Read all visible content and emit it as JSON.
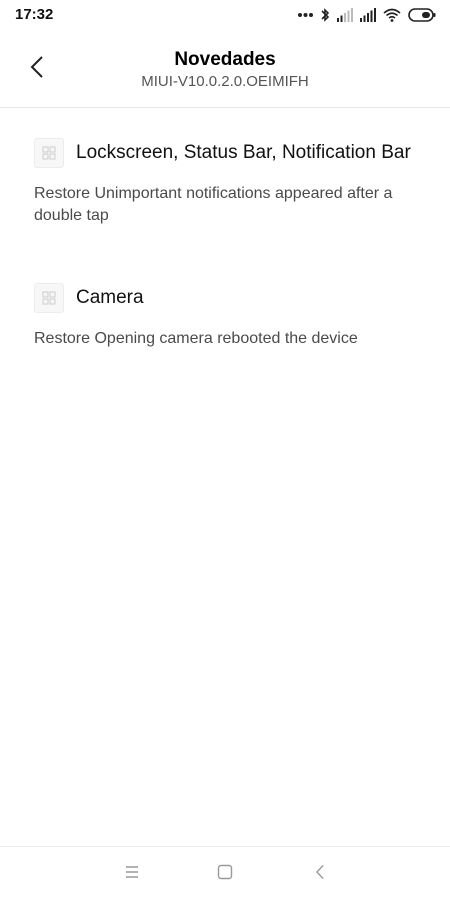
{
  "status_bar": {
    "time": "17:32",
    "icons": [
      "dots-icon",
      "bluetooth-icon",
      "signal-icon",
      "signal-icon",
      "wifi-icon",
      "battery-icon"
    ]
  },
  "header": {
    "title": "Novedades",
    "subtitle": "MIUI-V10.0.2.0.OEIMIFH"
  },
  "sections": [
    {
      "title": "Lockscreen, Status Bar, Notification Bar",
      "description": "Restore Unimportant notifications appeared after a double tap"
    },
    {
      "title": "Camera",
      "description": "Restore Opening camera rebooted the device"
    }
  ],
  "nav_bar": {
    "buttons": [
      "menu-icon",
      "home-icon",
      "back-icon"
    ]
  }
}
